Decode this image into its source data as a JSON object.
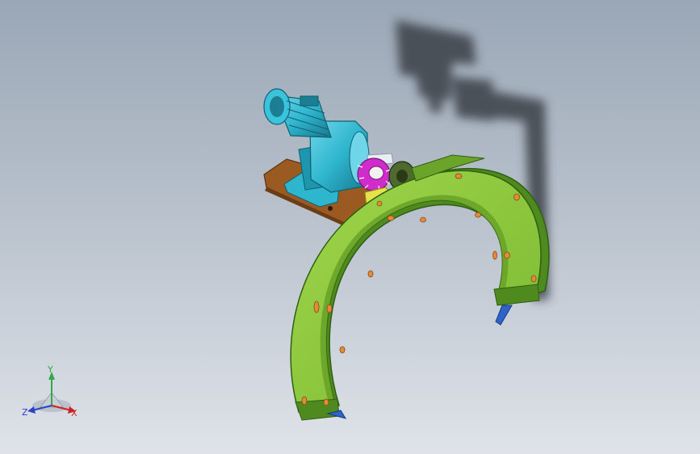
{
  "viewport": {
    "background_top": "#9aa7b6",
    "background_bottom": "#dfe3e9"
  },
  "model": {
    "colors": {
      "ring_green": "#8ec63f",
      "ring_dark_green": "#4f8a1e",
      "ring_edge": "#2f5f12",
      "bolt_orange": "#e08a3c",
      "motor_cyan": "#2fb6cf",
      "motor_dark": "#1b7e93",
      "base_brown": "#9b5a22",
      "gear_magenta": "#d02ccc",
      "foot_blue": "#2f63c9",
      "shadow_dark": "#3a3f47"
    }
  },
  "triad": {
    "x_label": "X",
    "y_label": "Y",
    "z_label": "Z",
    "x_color": "#cc2222",
    "y_color": "#33a84a",
    "z_color": "#2a43c9"
  }
}
